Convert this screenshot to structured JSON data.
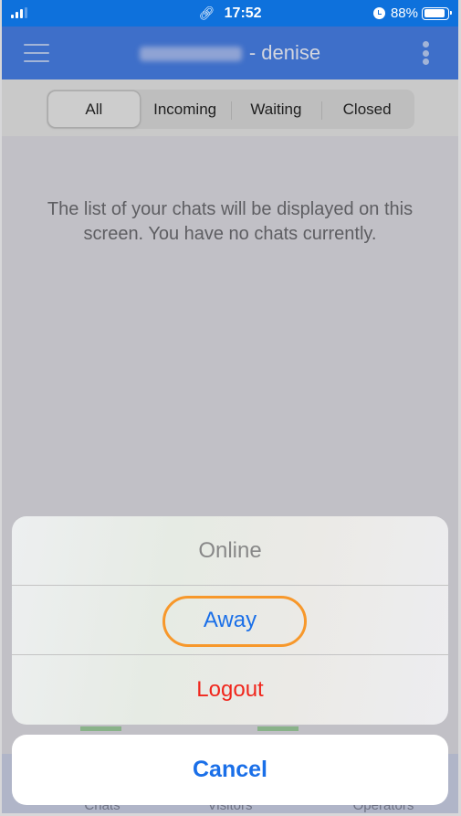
{
  "status_bar": {
    "time": "17:52",
    "battery_percent_label": "88%",
    "battery_level": 0.88,
    "signal_bars_active": 3,
    "signal_bars_total": 4,
    "icons": [
      "signal-icon",
      "link-icon",
      "alarm-icon",
      "battery-icon"
    ]
  },
  "header": {
    "title_redacted": true,
    "title_suffix": "- denise",
    "menu_icon": "hamburger-icon",
    "more_icon": "kebab-menu-icon"
  },
  "filters": {
    "tabs": [
      {
        "label": "All",
        "active": true
      },
      {
        "label": "Incoming",
        "active": false
      },
      {
        "label": "Waiting",
        "active": false
      },
      {
        "label": "Closed",
        "active": false
      }
    ]
  },
  "content": {
    "empty_message": "The list of your chats will be displayed on this screen. You have no chats currently."
  },
  "tab_bar": {
    "tabs": [
      {
        "label": "Chats"
      },
      {
        "label": "Visitors"
      },
      {
        "label": "Operators"
      }
    ]
  },
  "action_sheet": {
    "options": [
      {
        "label": "Online",
        "style": "disabled"
      },
      {
        "label": "Away",
        "style": "default",
        "highlighted": true
      },
      {
        "label": "Logout",
        "style": "destructive"
      }
    ],
    "cancel_label": "Cancel"
  },
  "colors": {
    "status_bar": "#0e71dc",
    "header": "#3e6fc9",
    "ios_blue": "#1a6fe8",
    "destructive_red": "#f0261c",
    "highlight_orange": "#f7982b"
  }
}
